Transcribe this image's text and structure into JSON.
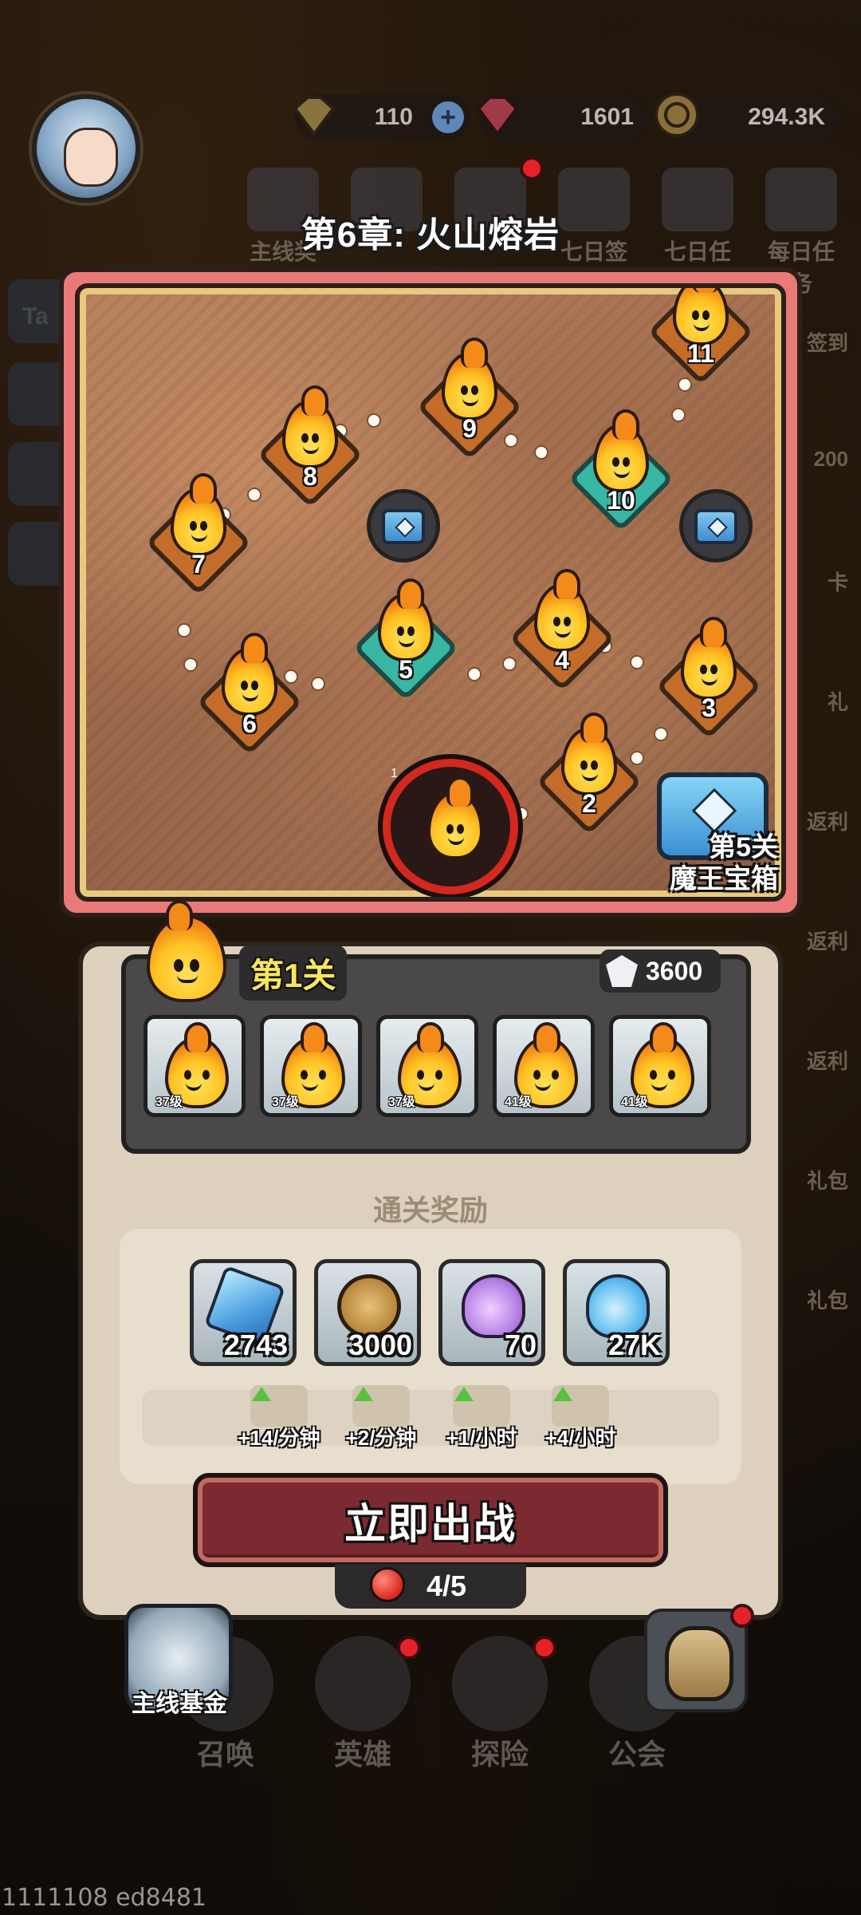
{
  "header": {
    "resources": [
      {
        "name": "gold-ingot",
        "value": "110",
        "has_plus": true
      },
      {
        "name": "red-gem",
        "value": "1601"
      },
      {
        "name": "coin",
        "value": "294.3K"
      }
    ],
    "top_menu": [
      "主线奖",
      "",
      "",
      "七日签到",
      "七日任务",
      "每日任务"
    ],
    "left_side": [
      "Ta"
    ],
    "right_side": [
      "签到",
      "200",
      "卡",
      "礼",
      "返利",
      "返利",
      "返利",
      "礼包",
      "礼包"
    ]
  },
  "chapter": {
    "title": "第6章: 火山熔岩",
    "nodes": [
      "1",
      "2",
      "3",
      "4",
      "5",
      "6",
      "7",
      "8",
      "9",
      "10",
      "11"
    ],
    "boss_chest_label_line1": "第5关",
    "boss_chest_label_line2": "魔王宝箱"
  },
  "stage": {
    "name": "第1关",
    "power": "3600",
    "enemies": [
      {
        "level": "37级"
      },
      {
        "level": "37级"
      },
      {
        "level": "37级"
      },
      {
        "level": "41级"
      },
      {
        "level": "41级"
      }
    ]
  },
  "rewards": {
    "title": "通关奖励",
    "items": [
      {
        "icon": "blue-crystal-icon",
        "amount": "2743"
      },
      {
        "icon": "gold-coin-icon",
        "amount": "3000"
      },
      {
        "icon": "purple-potion-icon",
        "amount": "70"
      },
      {
        "icon": "blue-potion-icon",
        "amount": "27K"
      }
    ],
    "rates": [
      "+14/分钟",
      "+2/分钟",
      "+1/小时",
      "+4/小时"
    ]
  },
  "battle_button": "立即出战",
  "stamina": "4/5",
  "bottom_nav": {
    "fund_label": "主线基金",
    "items": [
      "召唤",
      "英雄",
      "探险",
      "公会"
    ]
  },
  "footer_watermark": "1111108 ed8481"
}
